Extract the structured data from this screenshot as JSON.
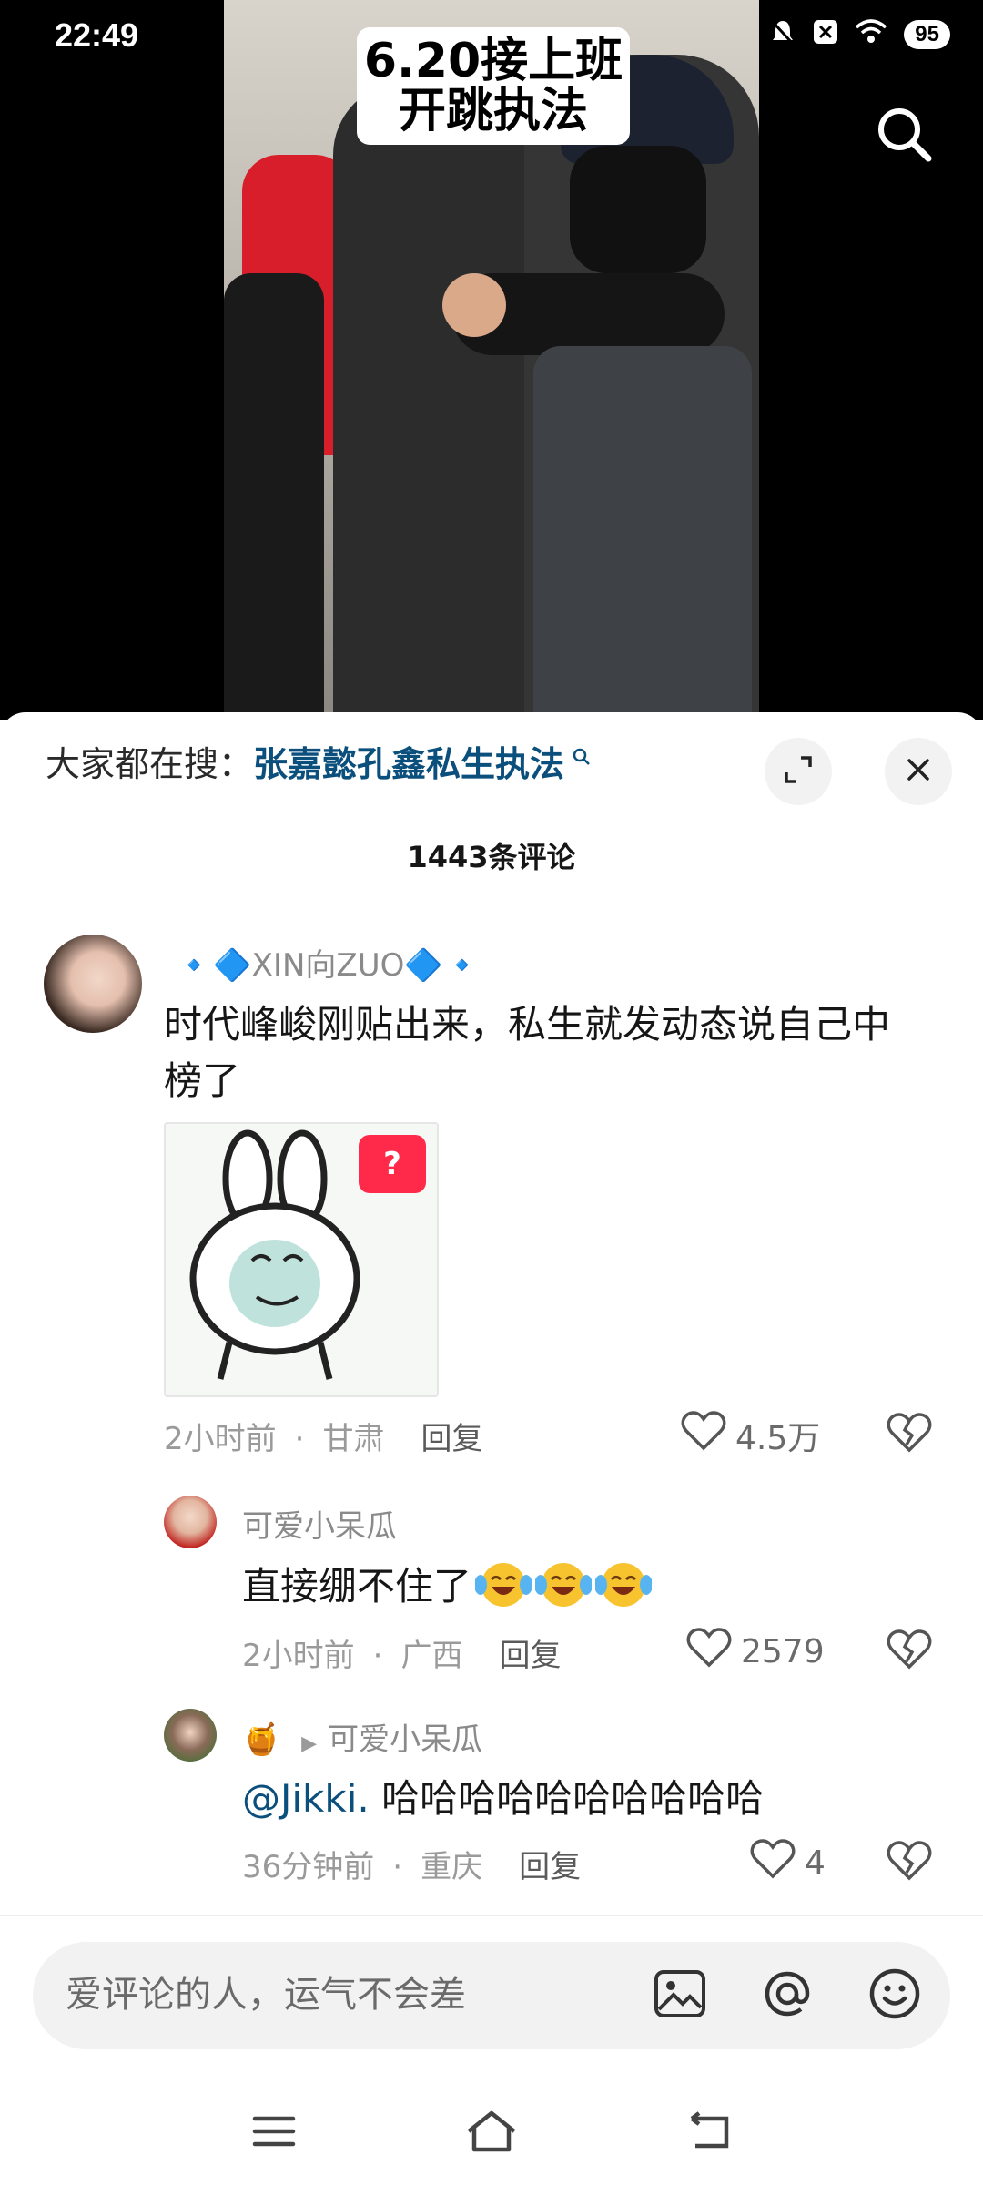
{
  "status_bar": {
    "time": "22:49",
    "battery": "95",
    "icons": [
      "mute-icon",
      "x-notification-icon",
      "wifi-icon",
      "battery-icon"
    ]
  },
  "video": {
    "caption_line1": "6.20接上班",
    "caption_line2": "开跳执法"
  },
  "sheet": {
    "hot_search_prefix": "大家都在搜：",
    "hot_search_term": "张嘉懿孔鑫私生执法",
    "comment_count": "1443条评论"
  },
  "comments": [
    {
      "username": "🔹🔷XIN向ZUO🔷🔹",
      "text": "时代峰峻刚贴出来，私生就发动态说自己中榜了",
      "sticker_badge": "?",
      "time": "2小时前",
      "location": "甘肃",
      "reply_label": "回复",
      "likes": "4.5万"
    }
  ],
  "replies": [
    {
      "username": "可爱小呆瓜",
      "text": "直接绷不住了",
      "emoji_count": 3,
      "time": "2小时前",
      "location": "广西",
      "reply_label": "回复",
      "likes": "2579"
    },
    {
      "username_prefix_emoji": "🍯",
      "username": "可爱小呆瓜",
      "mention": "@Jikki.",
      "text": " 哈哈哈哈哈哈哈哈哈哈",
      "time": "36分钟前",
      "location": "重庆",
      "reply_label": "回复",
      "likes": "4"
    }
  ],
  "input": {
    "placeholder": "爱评论的人，运气不会差"
  },
  "colors": {
    "link_blue": "#0b4f7d",
    "badge_red": "#ff2a4a",
    "meta_gray": "#9a9a9a"
  }
}
